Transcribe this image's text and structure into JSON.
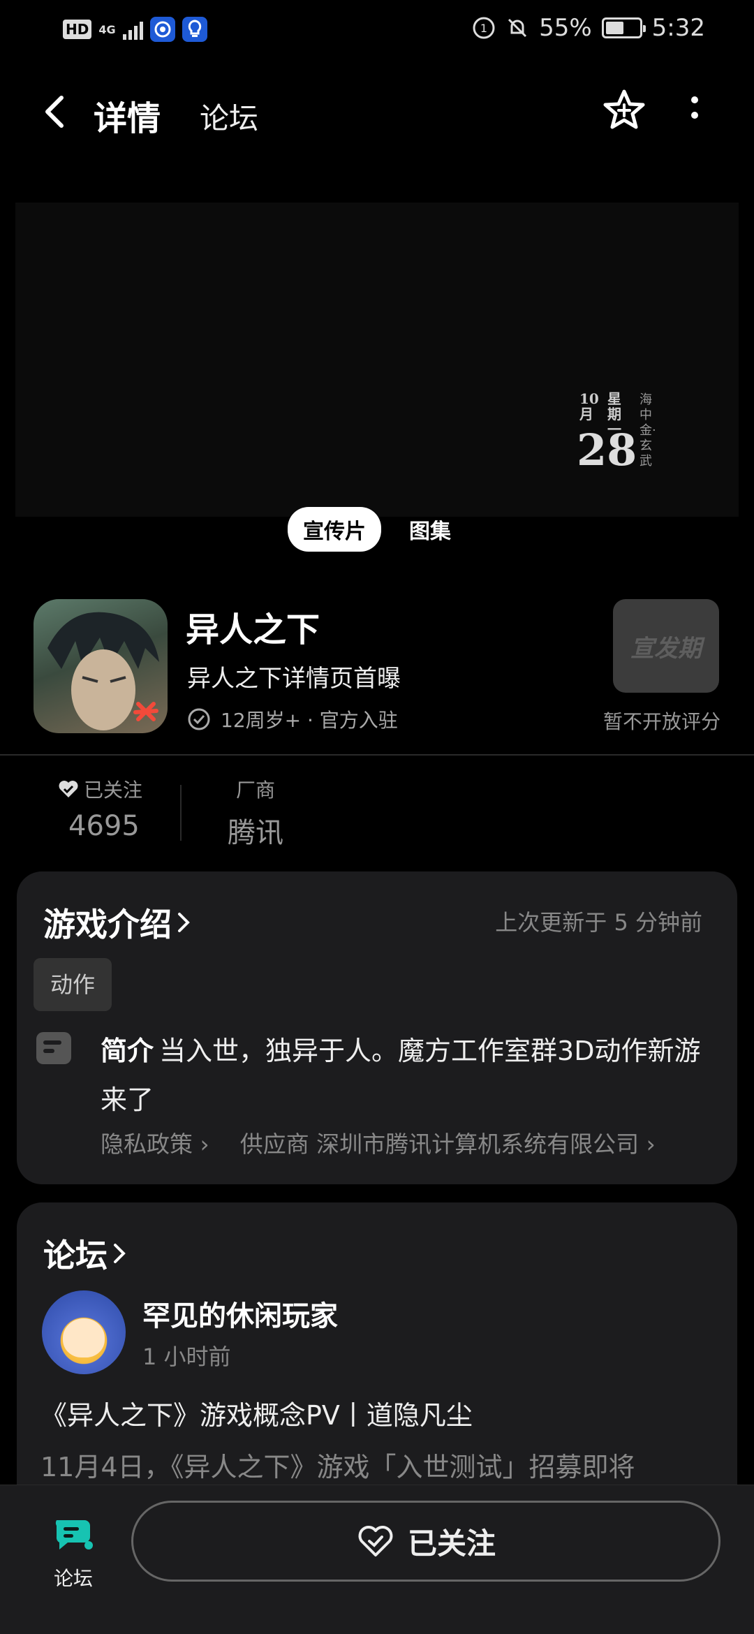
{
  "status_bar": {
    "hd": "HD",
    "network": "4G",
    "battery": "55%",
    "battery_level": 0.55,
    "time": "5:32"
  },
  "nav": {
    "tab_detail": "详情",
    "tab_forum": "论坛",
    "accent_color": "#17c3b2"
  },
  "banner": {
    "calendar_month": "10月",
    "calendar_week": "星期一",
    "calendar_day": "28",
    "calendar_side": "海中金·玄武",
    "media_tabs": [
      "宣传片",
      "图集"
    ]
  },
  "app": {
    "name": "异人之下",
    "subtitle": "异人之下详情页首曝",
    "meta": "12周岁+ · 官方入驻",
    "rating_badge": "宣发期",
    "rating_label": "暂不开放评分"
  },
  "stats": {
    "follow_label": "已关注",
    "follow_count": "4695",
    "vendor_label": "厂商",
    "vendor_value": "腾讯"
  },
  "intro": {
    "title": "游戏介绍",
    "updated": "上次更新于 5 分钟前",
    "tag": "动作",
    "desc_label": "简介",
    "desc_text": "当入世，独异于人。魔方工作室群3D动作新游来了",
    "privacy_link": "隐私政策",
    "supplier_link": "供应商 深圳市腾讯计算机系统有限公司"
  },
  "forum": {
    "title": "论坛",
    "poster_name": "罕见的休闲玩家",
    "poster_time": "1 小时前",
    "post_title": "《异人之下》游戏概念PV丨道隐凡尘",
    "post_excerpt": "11月4日，《异人之下》游戏「入世测试」招募即将"
  },
  "bottom": {
    "forum_label": "论坛",
    "follow_button": "已关注"
  }
}
